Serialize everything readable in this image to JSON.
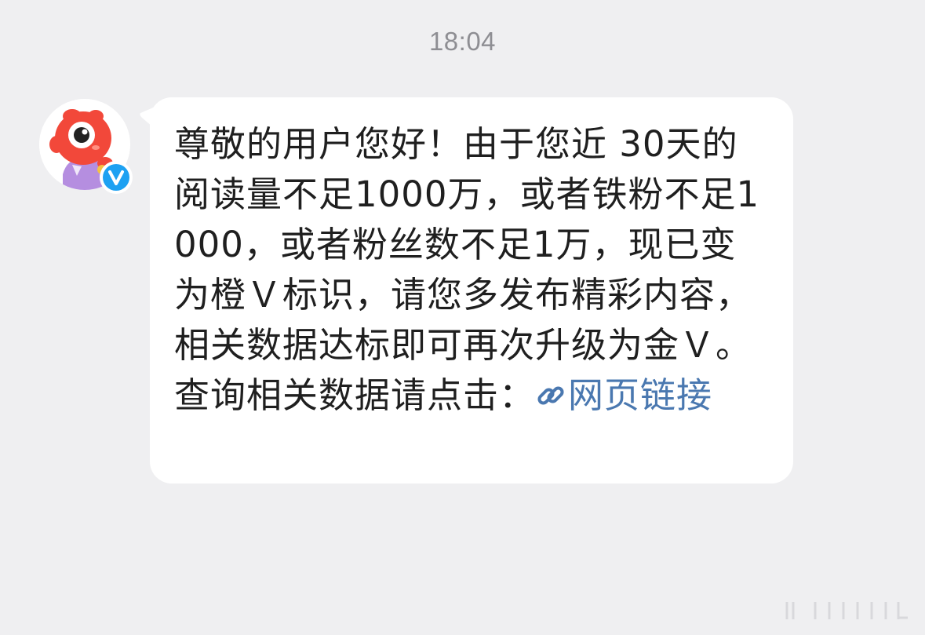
{
  "timestamp": "18:04",
  "sender": {
    "avatar_icon": "weibo-mascot-icon",
    "badge_icon": "verified-v-icon",
    "badge_color": "#1da1f2"
  },
  "message": {
    "text": "尊敬的用户您好！由于您近 30天的阅读量不足1000万，或者铁粉不足1000，或者粉丝数不足1万，现已变为橙Ｖ标识，请您多发布精彩内容，相关数据达标即可再次升级为金Ｖ。 查询相关数据请点击：",
    "link_icon": "link-icon",
    "link_text": "网页链接",
    "link_color": "#4a78b0"
  },
  "colors": {
    "background": "#efeff1",
    "bubble": "#ffffff",
    "text": "#1f1f1f",
    "timestamp": "#8e8e93"
  }
}
